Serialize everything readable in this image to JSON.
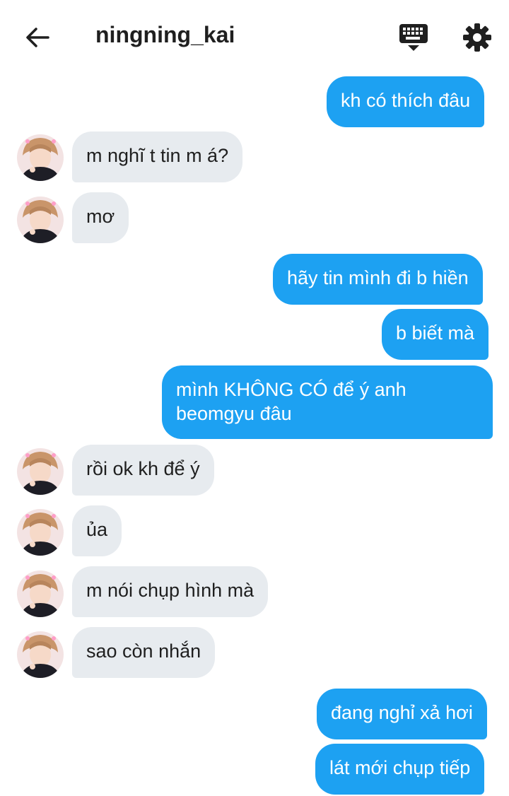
{
  "header": {
    "title": "ningning_kai",
    "icons": [
      "back-arrow-icon",
      "keyboard-icon",
      "gear-icon"
    ]
  },
  "colors": {
    "outgoing": "#1da1f2",
    "incoming": "#e7ebef"
  },
  "messages": [
    {
      "direction": "out",
      "text": "kh có thích đâu"
    },
    {
      "direction": "in",
      "text": "m nghĩ t tin m á?"
    },
    {
      "direction": "in",
      "text": "mơ"
    },
    {
      "direction": "out",
      "text": "hãy tin mình đi b hiền"
    },
    {
      "direction": "out",
      "text": "b biết mà"
    },
    {
      "direction": "out",
      "text": "mình KHÔNG CÓ để ý anh beomgyu đâu"
    },
    {
      "direction": "in",
      "text": "rồi ok kh để ý"
    },
    {
      "direction": "in",
      "text": "ủa"
    },
    {
      "direction": "in",
      "text": "m nói chụp hình mà"
    },
    {
      "direction": "in",
      "text": "sao còn nhắn"
    },
    {
      "direction": "out",
      "text": "đang nghỉ xả hơi"
    },
    {
      "direction": "out",
      "text": "lát mới chụp tiếp"
    }
  ]
}
